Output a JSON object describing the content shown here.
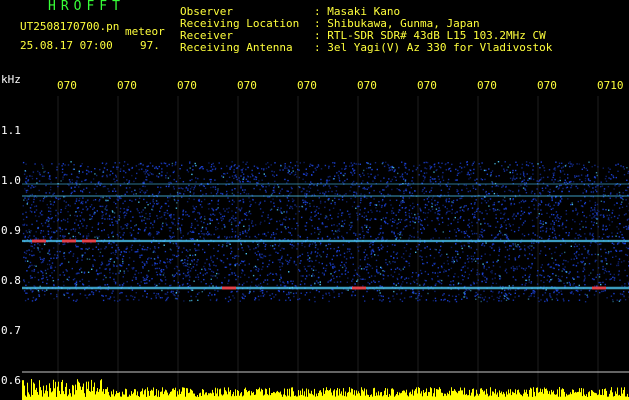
{
  "app": {
    "name": "HROFFT",
    "filename": "UT2508170700.pn",
    "mode": "meteor",
    "datetime": "25.08.17 07:00",
    "count": "97."
  },
  "info": {
    "labels": [
      "Observer",
      "Receiving Location",
      "Receiver",
      "Receiving Antenna"
    ],
    "values": [
      ": Masaki Kano",
      ": Shibukawa, Gunma, Japan",
      ": RTL-SDR SDR# 43dB L15 103.2MHz CW",
      ": 3el Yagi(V) Az 330 for Vladivostok"
    ]
  },
  "axis": {
    "unit": "kHz",
    "y_ticks": [
      "1.1",
      "1.0",
      "0.9",
      "0.8",
      "0.7",
      "0.6"
    ],
    "time_ticks": [
      "070",
      "070",
      "070",
      "070",
      "070",
      "070",
      "070",
      "070",
      "070",
      "0710"
    ]
  },
  "colors": {
    "background": "#000000",
    "header_yellow": "#ffff3c",
    "title_green": "#37ff37",
    "noise_blue": "#1e46e6",
    "echo_cyan": "#50d2ff",
    "echo_red": "#ff3232",
    "grid": "#c8c8c8",
    "bottom_bar": "#ffff00"
  }
}
